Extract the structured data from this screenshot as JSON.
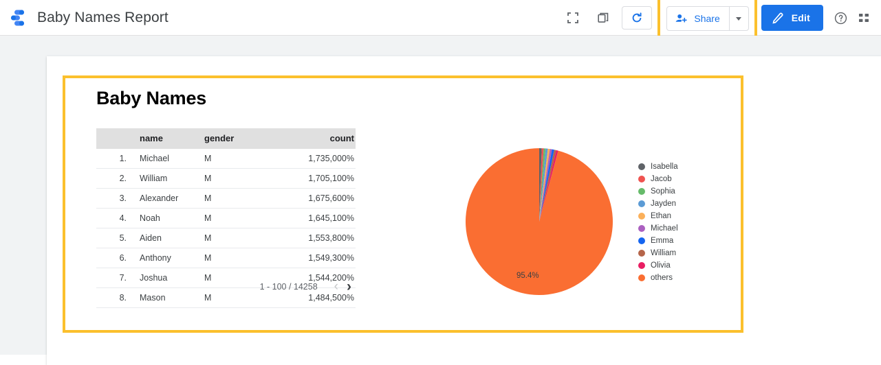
{
  "appbar": {
    "logo_icon": "data-studio-logo-icon",
    "title": "Baby Names Report",
    "fullscreen_icon": "fullscreen-icon",
    "copy_icon": "copy-icon",
    "refresh_icon": "refresh-icon",
    "share": {
      "icon": "person-add-icon",
      "label": "Share",
      "caret_icon": "chevron-down-icon",
      "highlighted": true,
      "highlight_color": "#fbc02d",
      "text_color": "#1a73e8"
    },
    "edit": {
      "icon": "pencil-icon",
      "label": "Edit",
      "bg_color": "#1a73e8"
    },
    "help_icon": "help-circle-icon",
    "apps_icon": "apps-grid-icon"
  },
  "report": {
    "highlight_color": "#fbc02d",
    "chart_title": "Baby Names"
  },
  "table": {
    "headers": [
      "name",
      "gender",
      "count"
    ],
    "rows": [
      {
        "idx": "1.",
        "name": "Michael",
        "gender": "M",
        "count": "1,735,000%"
      },
      {
        "idx": "2.",
        "name": "William",
        "gender": "M",
        "count": "1,705,100%"
      },
      {
        "idx": "3.",
        "name": "Alexander",
        "gender": "M",
        "count": "1,675,600%"
      },
      {
        "idx": "4.",
        "name": "Noah",
        "gender": "M",
        "count": "1,645,100%"
      },
      {
        "idx": "5.",
        "name": "Aiden",
        "gender": "M",
        "count": "1,553,800%"
      },
      {
        "idx": "6.",
        "name": "Anthony",
        "gender": "M",
        "count": "1,549,300%"
      },
      {
        "idx": "7.",
        "name": "Joshua",
        "gender": "M",
        "count": "1,544,200%"
      },
      {
        "idx": "8.",
        "name": "Mason",
        "gender": "M",
        "count": "1,484,500%"
      }
    ],
    "pagination": {
      "range_text": "1 - 100 / 14258",
      "prev_icon": "chevron-left-icon",
      "next_icon": "chevron-right-icon",
      "prev_disabled": true
    }
  },
  "chart_data": {
    "type": "pie",
    "title": "Baby Names",
    "labels": [
      "Isabella",
      "Jacob",
      "Sophia",
      "Jayden",
      "Ethan",
      "Michael",
      "Emma",
      "William",
      "Olivia",
      "others"
    ],
    "values": [
      0.55,
      0.42,
      0.42,
      0.48,
      0.45,
      0.45,
      0.5,
      0.45,
      0.43,
      95.4
    ],
    "colors": [
      "#5f6368",
      "#ef5350",
      "#66bb6a",
      "#5b9bd5",
      "#fbb05a",
      "#ab60c0",
      "#1565f0",
      "#b5654a",
      "#e91e63",
      "#fa6e32"
    ],
    "data_labels": [
      "95.4%"
    ],
    "legend_position": "right",
    "value_unit": "%"
  }
}
